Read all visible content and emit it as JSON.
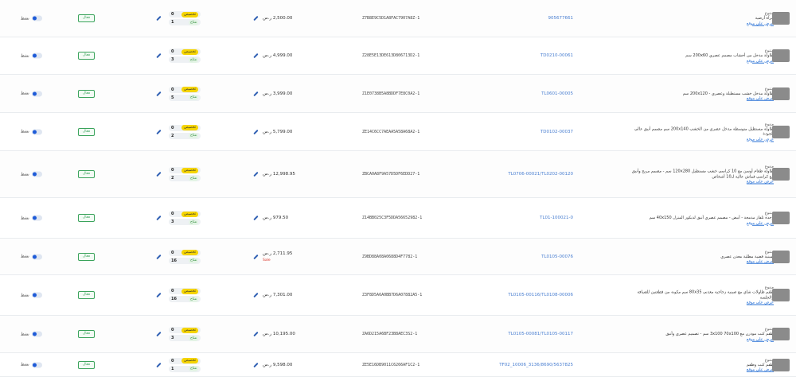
{
  "common": {
    "tag": "متنوع",
    "link": "عرض على موقع",
    "reserve": "تخصيص",
    "store": "متاح",
    "status": "فعال",
    "toggle": "نشط",
    "qty_top": "0"
  },
  "rows": [
    {
      "product": "مرآة أرضية",
      "sku": "905677661",
      "code": "Z7B8E9C5D1A8FAC7907A8Z-1",
      "price": "2,500.00 ر.س",
      "qty": "1"
    },
    {
      "product": "طاولة مدخل من أخشاب مصمم عصري 200x60 سم",
      "sku": "TD0210-00061",
      "code": "Z28E5E13DE613D806713D2-1",
      "price": "4,999.00 ر.س",
      "qty": "3"
    },
    {
      "product": "طاولة مدخل خشب مستطيلة وعصري - 200x120 سم",
      "sku": "TL0601-00005",
      "code": "Z1E0738B5A8BDDF7E8C0A2-1",
      "price": "3,999.00 ر.س",
      "qty": "5"
    },
    {
      "product": "طاولة مستطيل متوسطة مدخل عصري من الخشب 200x140 سم مصمم أنيق عالي الجودة",
      "sku": "TD0102-00037",
      "code": "ZE14C6CC7AEAA5A58A68A2-1",
      "price": "5,799.00 ر.س",
      "qty": "2"
    },
    {
      "product": "طاولة طعام أوسن مع 10 كراسي خشب مستطيل 120x280 سم - مصمم مريح وأنيق مع كراسي قماش عالية ل10 أشخاص",
      "sku": "TL0706-00021/TL0202-00120",
      "code": "ZBCA0A8F9A57D5DF6EDD27-1",
      "price": "12,998.95 ر.س",
      "qty": "2"
    },
    {
      "product": "وحدة تلفاز مدمجة - أبيض - مصمم عصري أنيق لديكور المنزل 40x150 سم",
      "sku": "TL01-100021-0",
      "code": "Z14BB025C3F5DDA56652982-1",
      "price": "979.50 ر.س",
      "qty": "3"
    },
    {
      "product": "صينية فضية مطلية معدن عصري",
      "sku": "TL0105-00076",
      "code": "Z9BD88A08A0688D4F7782-1",
      "price": "2,711.95 ر.س",
      "qty": "16",
      "sale": "Sale"
    },
    {
      "product": "طقم طاولات شاي مع صينية زجاجية معدني 80x35 سم مكونة من قطعتين للضيافة والجلسة",
      "sku": "TL0105-00116/TL0108-00006",
      "code": "Z3F8D5A6A0BB7D6A07882A5-1",
      "price": "7,301.00 ر.س",
      "qty": "16"
    },
    {
      "product": "طقم كنب مودرن مع 3x100 70x100 سم - تصميم عصري وأنيق",
      "sku": "TL0105-00081/TL0105-00117",
      "code": "ZA6D215A6BF23B8AEC3S2-1",
      "price": "10,195.00 ر.س",
      "qty": "3"
    },
    {
      "product": "طقم كنب وطقم",
      "sku": "TF02_10006_3136/8690/5637825",
      "code": "ZE5E16DB9011C6266AF1C2-1",
      "price": "9,598.00 ر.س",
      "qty": "1"
    }
  ]
}
